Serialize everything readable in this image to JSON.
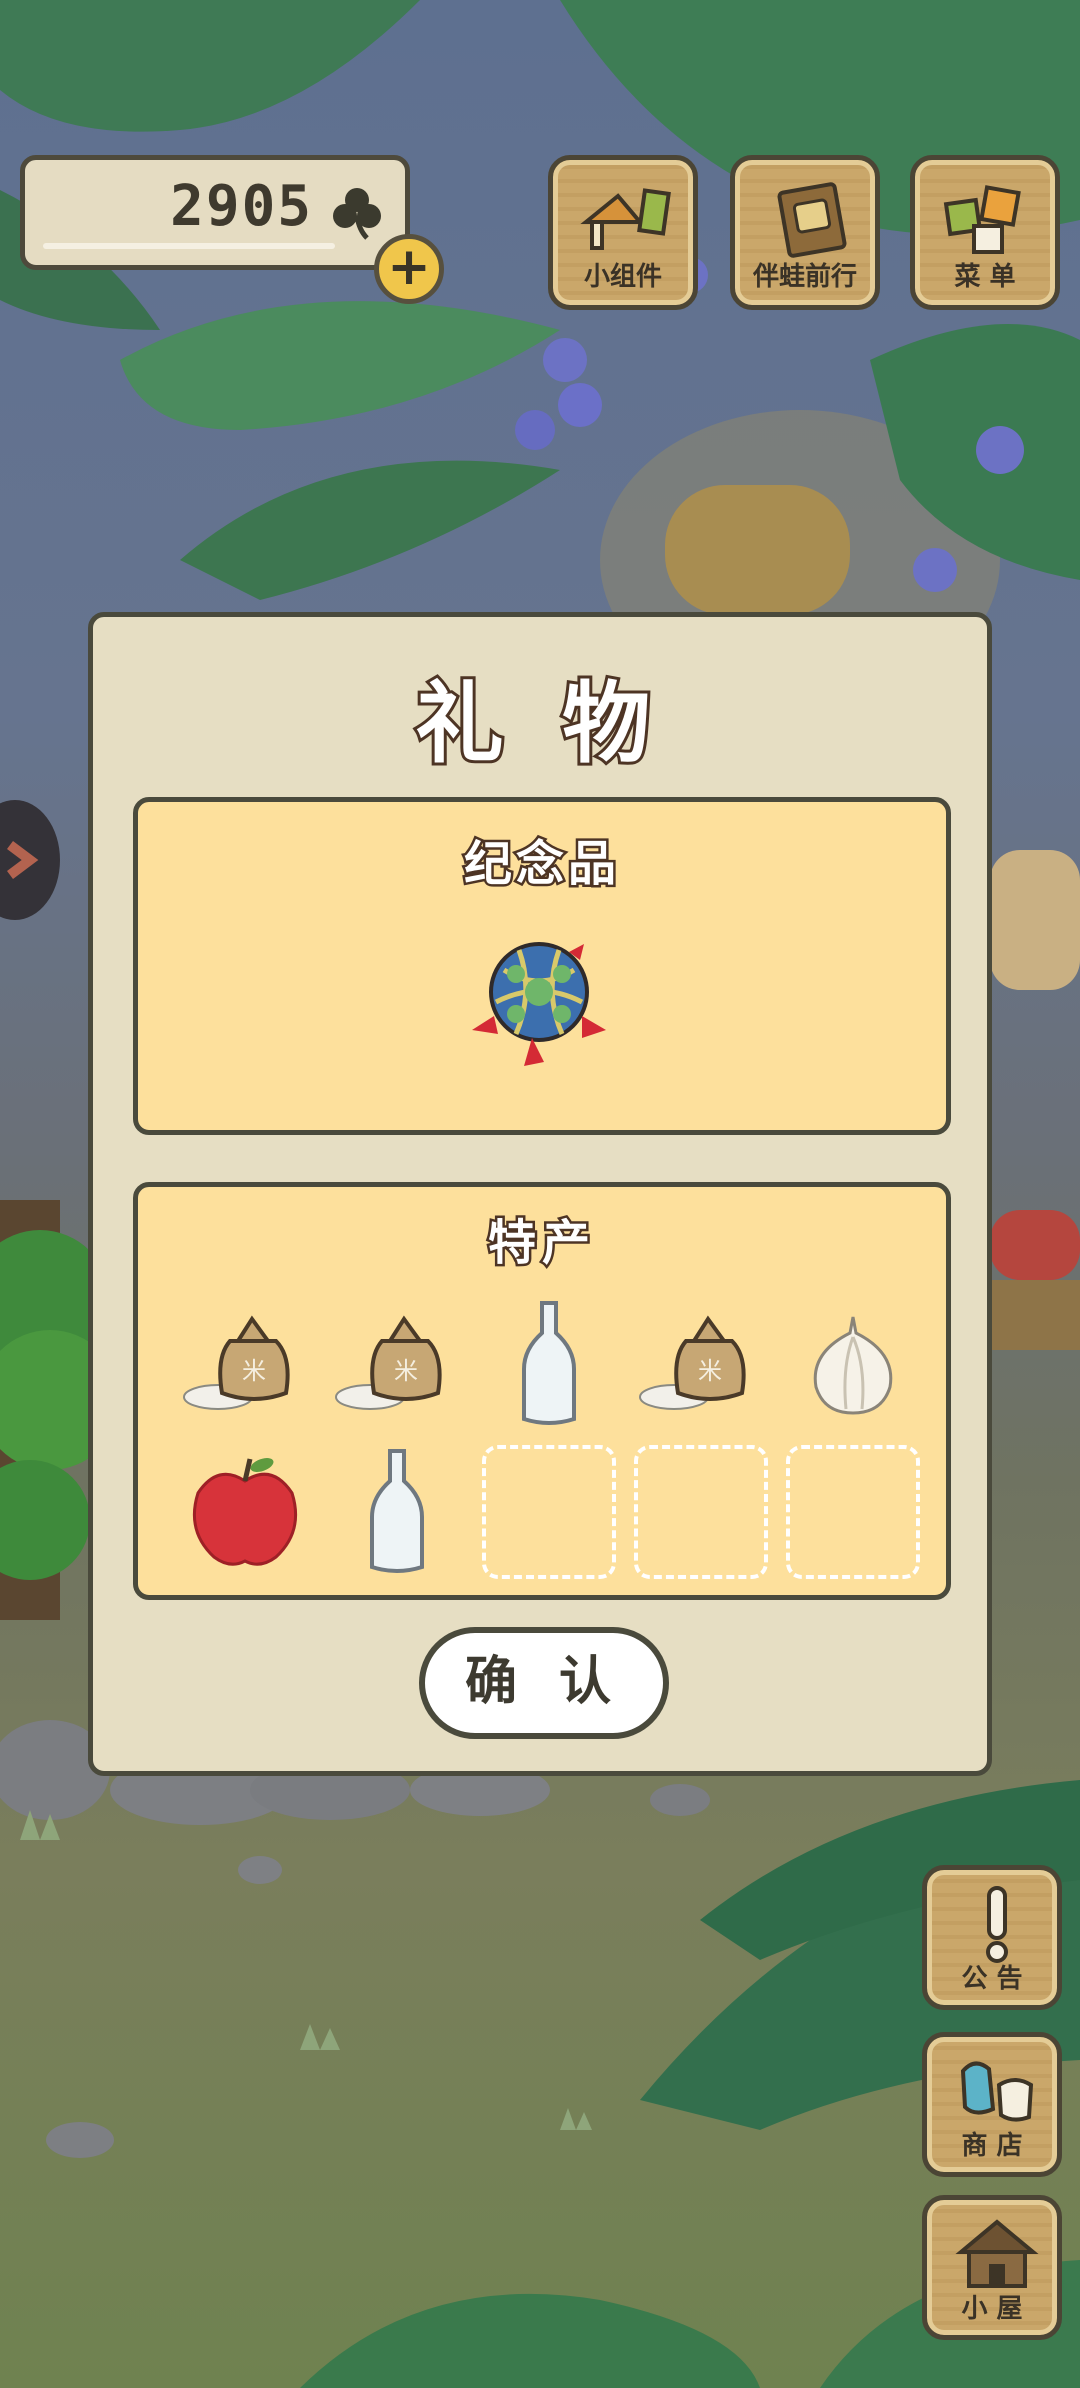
{
  "hud": {
    "clover_count": "2905",
    "plus_label": "+",
    "buttons": [
      {
        "label": "小组件",
        "icon": "widget-icon"
      },
      {
        "label": "伴蛙前行",
        "icon": "journal-icon"
      },
      {
        "label": "菜 单",
        "icon": "menu-icon"
      }
    ]
  },
  "side_buttons": [
    {
      "label": "公 告",
      "icon": "exclamation-icon"
    },
    {
      "label": "商 店",
      "icon": "shop-icon"
    },
    {
      "label": "小 屋",
      "icon": "house-icon"
    }
  ],
  "dialog": {
    "title": "礼 物",
    "souvenir": {
      "title": "纪念品",
      "item": "temari-ball-icon"
    },
    "specialty": {
      "title": "特产",
      "items": [
        "rice-bag-icon",
        "rice-bag-icon",
        "glass-bottle-icon",
        "rice-bag-icon",
        "garlic-icon",
        "apple-icon",
        "glass-bottle-icon",
        "empty",
        "empty",
        "empty"
      ]
    },
    "confirm_label": "确 认"
  },
  "colors": {
    "dialog_bg": "#e6dec3",
    "panel_bg": "#fde09c",
    "border": "#4a4a3c",
    "title_stroke": "#4d3424"
  }
}
